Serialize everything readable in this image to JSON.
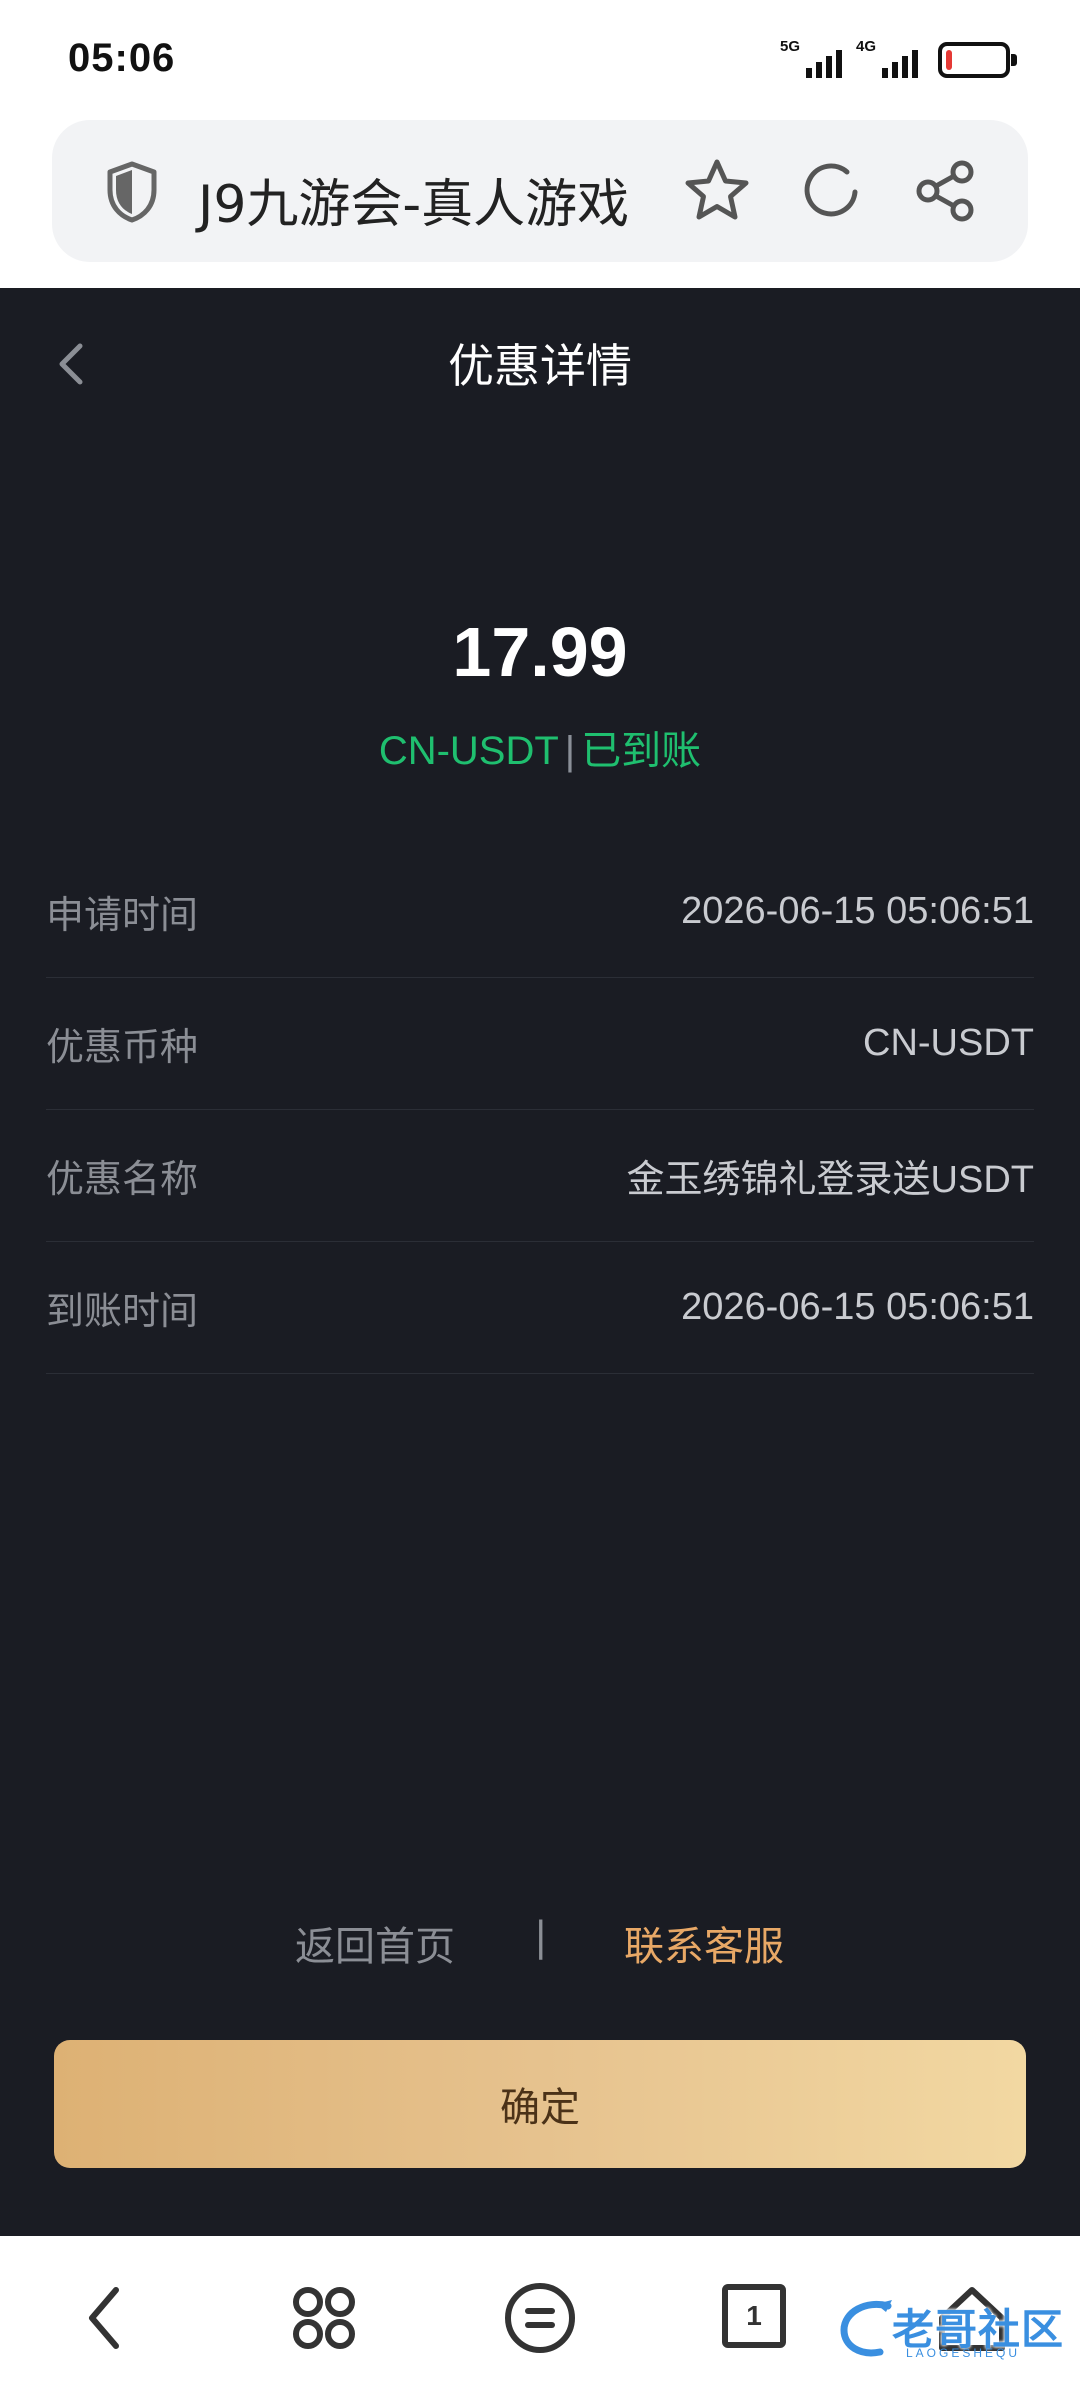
{
  "status_bar": {
    "time": "05:06",
    "signal_1": "5G",
    "signal_2": "4G",
    "battery_level": 0.1,
    "battery_color": "#e53935"
  },
  "browser": {
    "title": "J9九游会-真人游戏",
    "icons": [
      "shield-icon",
      "star-icon",
      "reload-icon",
      "share-icon"
    ]
  },
  "header": {
    "title": "优惠详情"
  },
  "summary": {
    "amount": "17.99",
    "currency": "CN-USDT",
    "separator": "|",
    "status": "已到账",
    "status_color": "#1fbf6f"
  },
  "details": [
    {
      "label": "申请时间",
      "value": "2026-06-15 05:06:51"
    },
    {
      "label": "优惠币种",
      "value": "CN-USDT"
    },
    {
      "label": "优惠名称",
      "value": "金玉绣锦礼登录送USDT"
    },
    {
      "label": "到账时间",
      "value": "2026-06-15 05:06:51"
    }
  ],
  "links": {
    "home": "返回首页",
    "divider": "|",
    "service": "联系客服"
  },
  "confirm_label": "确定",
  "bottom_nav": {
    "tab_count": "1",
    "icons": [
      "back-icon",
      "menu-icon",
      "list-icon",
      "tabs-icon",
      "home-icon"
    ]
  },
  "watermark": {
    "text": "老哥社区",
    "subtext": "LAOGESHEQU"
  }
}
